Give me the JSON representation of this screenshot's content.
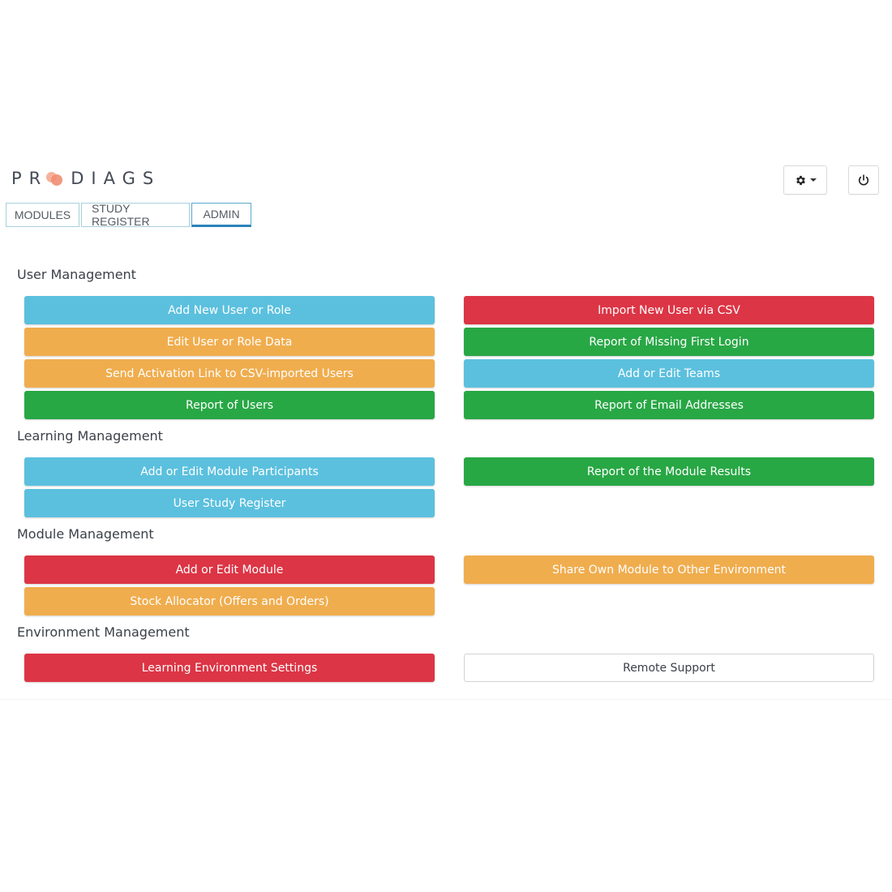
{
  "brand": {
    "logo_left": "PR",
    "logo_right": "DIAGS"
  },
  "tabs": [
    {
      "label": "MODULES"
    },
    {
      "label": "STUDY REGISTER"
    },
    {
      "label": "ADMIN",
      "active": true
    }
  ],
  "icons": {
    "settings": "gear-icon",
    "power": "power-icon"
  },
  "colors": {
    "info": "#5bc0de",
    "warning": "#f0ad4e",
    "success": "#28a745",
    "danger": "#dc3545",
    "tab_active_underline": "#2a82b8",
    "logo_dot": "#ef8e72"
  },
  "sections": {
    "user_management": {
      "title": "User Management",
      "buttons": {
        "add_new_user": "Add New User or Role",
        "import_csv": "Import New User via CSV",
        "edit_user": "Edit User or Role Data",
        "missing_login": "Report of Missing First Login",
        "send_activation": "Send Activation Link to CSV-imported Users",
        "add_teams": "Add or Edit Teams",
        "report_users": "Report of Users",
        "report_emails": "Report of Email Addresses"
      }
    },
    "learning_management": {
      "title": "Learning Management",
      "buttons": {
        "module_participants": "Add or Edit Module Participants",
        "module_results": "Report of the Module Results",
        "user_study_register": "User Study Register"
      }
    },
    "module_management": {
      "title": "Module Management",
      "buttons": {
        "add_module": "Add or Edit Module",
        "share_module": "Share Own Module to Other Environment",
        "stock_allocator": "Stock Allocator (Offers and Orders)"
      }
    },
    "environment_management": {
      "title": "Environment Management",
      "buttons": {
        "env_settings": "Learning Environment Settings",
        "remote_support": "Remote Support"
      }
    }
  }
}
